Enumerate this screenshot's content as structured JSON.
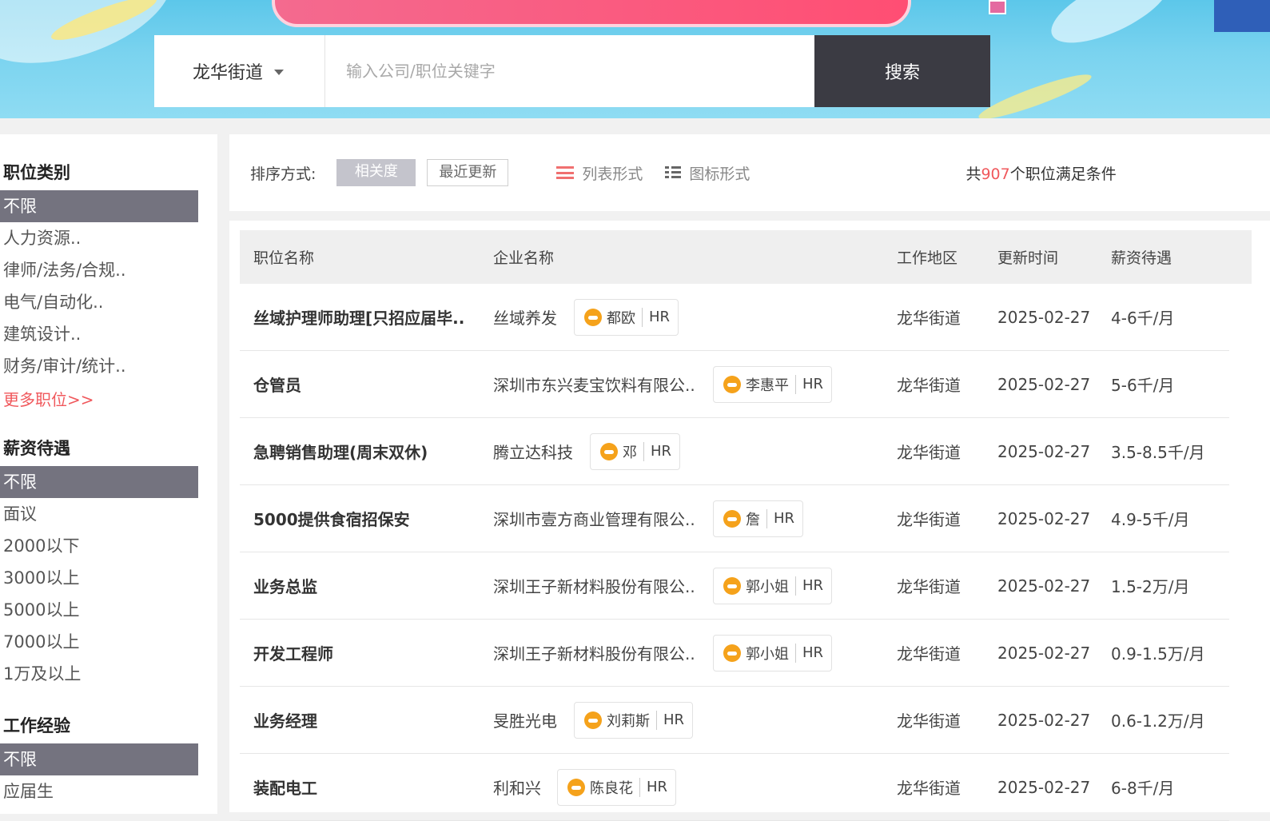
{
  "search": {
    "area_label": "龙华街道",
    "placeholder": "输入公司/职位关键字",
    "button_label": "搜索"
  },
  "sidebar": {
    "job_category": {
      "title": "职位类别",
      "items": [
        "不限",
        "人力资源..",
        "律师/法务/合规..",
        "电气/自动化..",
        "建筑设计..",
        "财务/审计/统计.."
      ],
      "more": "更多职位>>"
    },
    "salary": {
      "title": "薪资待遇",
      "items": [
        "不限",
        "面议",
        "2000以下",
        "3000以上",
        "5000以上",
        "7000以上",
        "1万及以上"
      ]
    },
    "experience": {
      "title": "工作经验",
      "items": [
        "不限",
        "应届生"
      ]
    }
  },
  "toolbar": {
    "sort_label": "排序方式:",
    "sort_relevance": "相关度",
    "sort_recent": "最近更新",
    "view_list": "列表形式",
    "view_icon": "图标形式",
    "count_prefix": "共",
    "count_value": "907",
    "count_suffix": "个职位满足条件"
  },
  "table": {
    "headers": {
      "title": "职位名称",
      "company": "企业名称",
      "area": "工作地区",
      "date": "更新时间",
      "salary": "薪资待遇"
    },
    "hr_suffix": "HR",
    "rows": [
      {
        "title": "丝域护理师助理[只招应届毕..",
        "company": "丝域养发",
        "hr": "都欧",
        "area": "龙华街道",
        "date": "2025-02-27",
        "salary": "4-6千/月"
      },
      {
        "title": "仓管员",
        "company": "深圳市东兴麦宝饮料有限公..",
        "hr": "李惠平",
        "area": "龙华街道",
        "date": "2025-02-27",
        "salary": "5-6千/月"
      },
      {
        "title": "急聘销售助理(周末双休)",
        "company": "腾立达科技",
        "hr": "邓",
        "area": "龙华街道",
        "date": "2025-02-27",
        "salary": "3.5-8.5千/月"
      },
      {
        "title": "5000提供食宿招保安",
        "company": "深圳市壹方商业管理有限公..",
        "hr": "詹",
        "area": "龙华街道",
        "date": "2025-02-27",
        "salary": "4.9-5千/月"
      },
      {
        "title": "业务总监",
        "company": "深圳王子新材料股份有限公..",
        "hr": "郭小姐",
        "area": "龙华街道",
        "date": "2025-02-27",
        "salary": "1.5-2万/月"
      },
      {
        "title": "开发工程师",
        "company": "深圳王子新材料股份有限公..",
        "hr": "郭小姐",
        "area": "龙华街道",
        "date": "2025-02-27",
        "salary": "0.9-1.5万/月"
      },
      {
        "title": "业务经理",
        "company": "旻胜光电",
        "hr": "刘莉斯",
        "area": "龙华街道",
        "date": "2025-02-27",
        "salary": "0.6-1.2万/月"
      },
      {
        "title": "装配电工",
        "company": "利和兴",
        "hr": "陈良花",
        "area": "龙华街道",
        "date": "2025-02-27",
        "salary": "6-8千/月"
      }
    ]
  },
  "colors": {
    "accent_red": "#f0585c",
    "active_filter": "#74737f",
    "search_button": "#3b3b43",
    "chat_icon": "#f5a21b"
  }
}
